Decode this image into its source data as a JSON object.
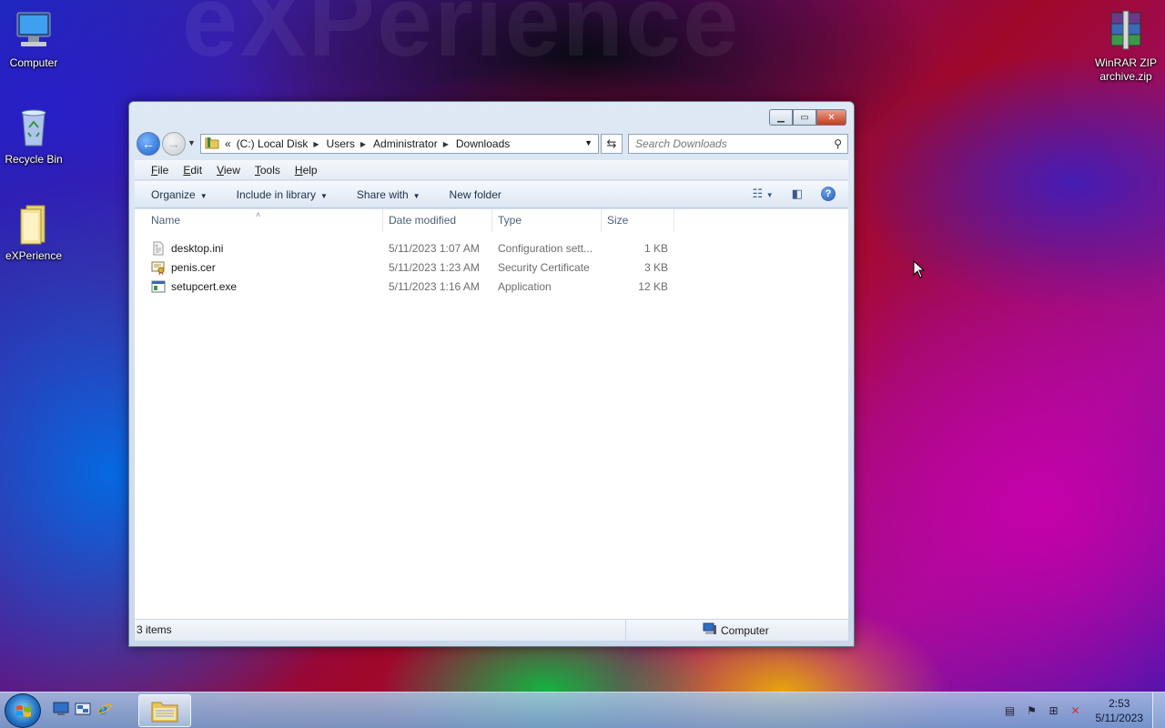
{
  "desktop": {
    "icons": [
      {
        "label": "Computer"
      },
      {
        "label": "Recycle Bin"
      },
      {
        "label": "eXPerience"
      },
      {
        "label": "WinRAR ZIP archive.zip"
      }
    ]
  },
  "window": {
    "address": {
      "overflow": "«",
      "crumbs": [
        "(C:) Local Disk",
        "Users",
        "Administrator",
        "Downloads"
      ]
    },
    "search_placeholder": "Search Downloads",
    "menu": [
      {
        "key": "F",
        "rest": "ile"
      },
      {
        "key": "E",
        "rest": "dit"
      },
      {
        "key": "V",
        "rest": "iew"
      },
      {
        "key": "T",
        "rest": "ools"
      },
      {
        "key": "H",
        "rest": "elp"
      }
    ],
    "toolbar": {
      "organize": "Organize",
      "include": "Include in library",
      "share": "Share with",
      "new_folder": "New folder"
    },
    "columns": {
      "name": "Name",
      "date": "Date modified",
      "type": "Type",
      "size": "Size"
    },
    "files": [
      {
        "name": "desktop.ini",
        "date": "5/11/2023 1:07 AM",
        "type": "Configuration sett...",
        "size": "1 KB",
        "icon": "ini-file-icon"
      },
      {
        "name": "penis.cer",
        "date": "5/11/2023 1:23 AM",
        "type": "Security Certificate",
        "size": "3 KB",
        "icon": "certificate-icon"
      },
      {
        "name": "setupcert.exe",
        "date": "5/11/2023 1:16 AM",
        "type": "Application",
        "size": "12 KB",
        "icon": "exe-file-icon"
      }
    ],
    "status": {
      "count": "3 items",
      "zone": "Computer"
    }
  },
  "taskbar": {
    "clock_time": "2:53",
    "clock_date": "5/11/2023"
  },
  "colors": {
    "accent": "#1c5fc8",
    "taskbar": "#8fb3da"
  }
}
